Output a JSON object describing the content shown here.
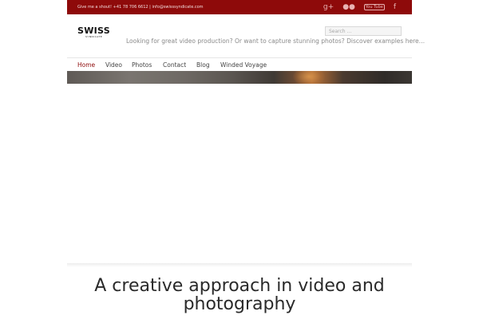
{
  "topbar": {
    "contact": "Give me a shout! +41 78 706 6612  |  info@swisssyndicate.com",
    "icons": [
      "google-plus-icon",
      "flickr-icon",
      "youtube-icon",
      "facebook-icon"
    ],
    "gplus_glyph": "g+",
    "flickr_glyph": "●●",
    "youtube_glyph": "You Tube",
    "facebook_glyph": "f",
    "color": "#8e0a0a"
  },
  "header": {
    "logo_name": "SWISS",
    "logo_sub": "SYNDICATE",
    "search_placeholder": "Search ...",
    "tagline": "Looking for great video production? Or want to capture stunning photos? Discover examples here…"
  },
  "nav": {
    "items": [
      {
        "label": "Home",
        "active": true
      },
      {
        "label": "Video"
      },
      {
        "label": "Photos"
      },
      {
        "label": "Contact"
      },
      {
        "label": "Blog"
      },
      {
        "label": "Winded Voyage"
      }
    ],
    "active_color": "#8e0a0a"
  },
  "main": {
    "headline": "A creative approach in video and photography"
  }
}
